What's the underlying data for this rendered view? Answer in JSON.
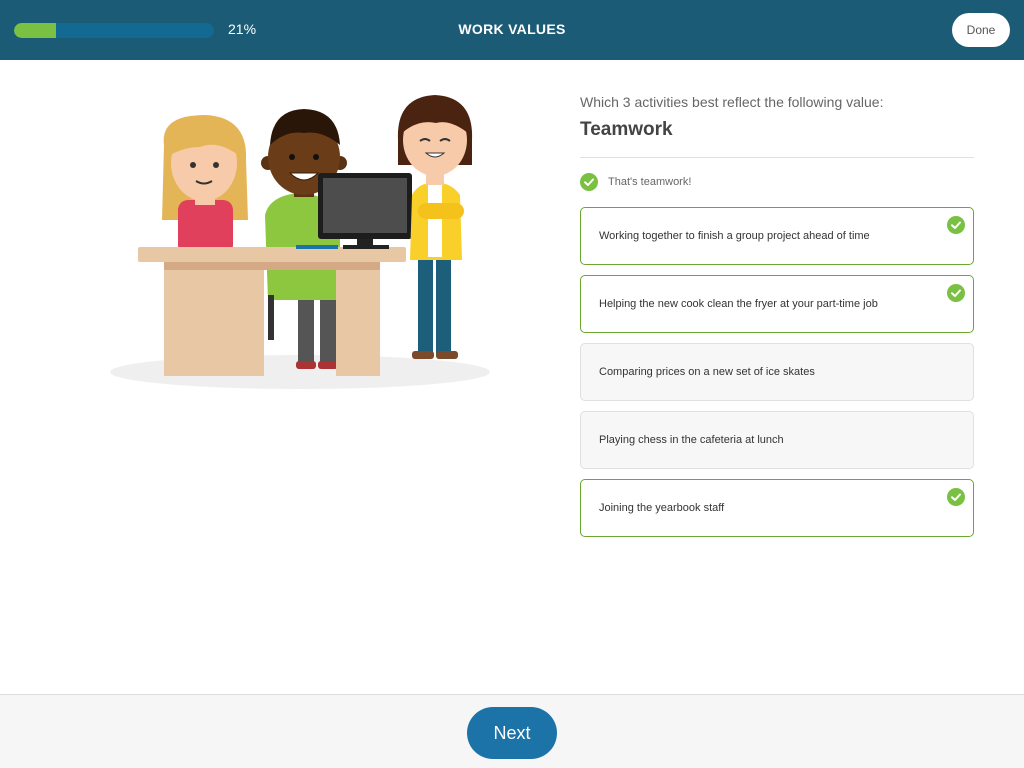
{
  "header": {
    "progress_percent": 21,
    "progress_label": "21%",
    "title": "WORK VALUES",
    "done_label": "Done"
  },
  "question": {
    "prompt": "Which 3 activities best reflect the following value:",
    "value": "Teamwork",
    "feedback": "That's teamwork!"
  },
  "options": [
    {
      "label": "Working together to finish a group project ahead of time",
      "selected": true
    },
    {
      "label": "Helping the new cook clean the fryer at your part-time job",
      "selected": true
    },
    {
      "label": "Comparing prices on a new set of ice skates",
      "selected": false
    },
    {
      "label": "Playing chess in the cafeteria at lunch",
      "selected": false
    },
    {
      "label": "Joining the yearbook staff",
      "selected": true
    }
  ],
  "footer": {
    "next_label": "Next"
  },
  "colors": {
    "header": "#1b5b75",
    "accent_green": "#7ac143",
    "next_blue": "#1b73a8"
  },
  "icons": {
    "check": "check-circle-icon"
  }
}
